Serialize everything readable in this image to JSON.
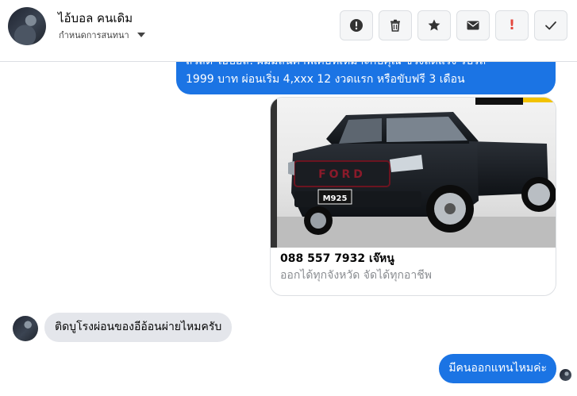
{
  "header": {
    "contact_name": "ไอ้บอล คนเดิม",
    "assign_label": "กำหนดการสนทนา",
    "actions": [
      {
        "name": "report",
        "icon": "exclamation-circle-icon"
      },
      {
        "name": "delete",
        "icon": "trash-icon"
      },
      {
        "name": "star",
        "icon": "star-icon"
      },
      {
        "name": "mark-unread",
        "icon": "envelope-icon"
      },
      {
        "name": "important",
        "icon": "exclamation-icon",
        "glyph": "!"
      },
      {
        "name": "done",
        "icon": "check-icon"
      }
    ]
  },
  "messages": {
    "outgoing_top": {
      "line1": "สวัสดี ไอ้บอล! ผมมีสินค้าพิเศษที่เหมาะกับคุณ ช่วงลดแรง รับรถ",
      "line2": "1999 บาท ผ่อนเริ่ม 4,xxx 12 งวดแรก หรือขับฟรี 3 เดือน"
    },
    "card": {
      "plate": "M925",
      "title": "088 557 7932 เจ๊หนู",
      "subtitle": "ออกได้ทุกจังหวัด จัดได้ทุกอาชีพ"
    },
    "incoming": "ติดบูโรงผ่อนของอีอ้อนผ่ายไหมครับ",
    "outgoing_last": "มีคนออกแทนไหมค่ะ"
  },
  "colors": {
    "bubble_out": "#1b74e4",
    "bubble_in": "#e4e6eb",
    "alert": "#e4463c"
  }
}
